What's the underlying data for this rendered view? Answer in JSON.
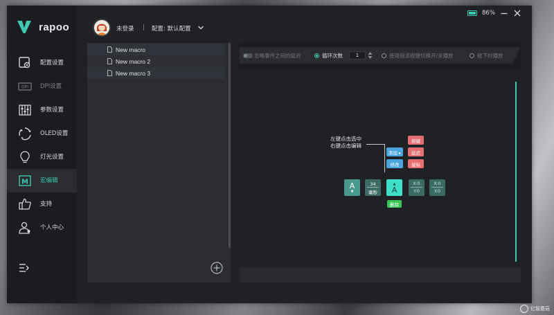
{
  "app": {
    "brand": "rapoo"
  },
  "header": {
    "user": "未登录",
    "separator": "|",
    "profile": "配置: 默认配置"
  },
  "battery": {
    "percent_text": "86%",
    "level": 0.86
  },
  "sidebar": {
    "items": [
      {
        "label": "配置设置",
        "icon": "config-icon"
      },
      {
        "label": "DPI设置",
        "icon": "dpi-icon"
      },
      {
        "label": "参数设置",
        "icon": "sliders-icon"
      },
      {
        "label": "OLED设置",
        "icon": "oled-icon"
      },
      {
        "label": "灯光设置",
        "icon": "bulb-icon"
      },
      {
        "label": "宏编辑",
        "icon": "macro-icon"
      },
      {
        "label": "支持",
        "icon": "thumbs-up-icon"
      },
      {
        "label": "个人中心",
        "icon": "user-icon"
      }
    ],
    "dpi_icon_text": "DPI",
    "macro_icon_text": "M"
  },
  "macros": {
    "items": [
      "New macro",
      "New macro 2",
      "New macro 3"
    ]
  },
  "options": {
    "ignore_delay": "忽略事件之间的延迟",
    "loop_count_label": "循环次数",
    "loop_count_value": "1",
    "toggle_mode": "使用指派按键切换开/关播放",
    "hold_play": "按下时播放"
  },
  "hint": {
    "line1": "左键点击选中",
    "line2": "右键点击编辑"
  },
  "actions": {
    "key": "按键",
    "delay": "延迟",
    "mouse": "鼠标",
    "add": "添加 ▸",
    "modify": "修改",
    "delete": "删除"
  },
  "nodes": {
    "key1": {
      "letter": "A",
      "arrow": "▼"
    },
    "delay": {
      "value": "34",
      "unit": "毫秒"
    },
    "key2": {
      "letter": "A",
      "arrow": "▲"
    },
    "coord1": {
      "x": "X:0",
      "y": "Y:0"
    },
    "coord2": {
      "x": "X:0",
      "y": "Y:0"
    }
  },
  "colors": {
    "accent": "#3fc9b0",
    "red": "#e76d71",
    "blue": "#4aa5dd",
    "green": "#39c75a"
  },
  "watermark": {
    "text": "亿智蘑菇"
  }
}
